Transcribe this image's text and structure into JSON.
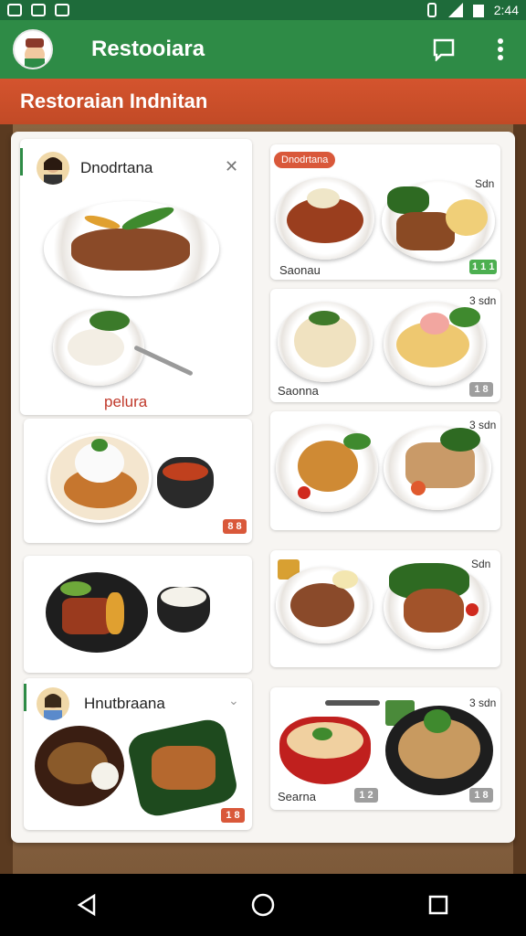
{
  "status_bar": {
    "time": "2:44"
  },
  "app_bar": {
    "title": "Restooiara"
  },
  "sub_header": {
    "title": "Restoraian Indnitan"
  },
  "left_cards": [
    {
      "title": "Dnodrtana",
      "label": "pelura"
    },
    {
      "badge": "8 8"
    },
    {},
    {
      "title": "Hnutbraana",
      "badge": "1 8"
    }
  ],
  "right_cards": [
    {
      "tag": "Dnodrtana",
      "corner": "Sdn",
      "caption": "Saonau",
      "badge": "1 1 1"
    },
    {
      "corner": "3 sdn",
      "caption": "Saonna",
      "badge": "1 8"
    },
    {
      "corner": "3 sdn"
    },
    {
      "corner": "Sdn"
    },
    {
      "corner": "3 sdn",
      "caption": "Searna",
      "badge1": "1 2",
      "badge2": "1 8"
    }
  ],
  "colors": {
    "app_bar": "#2e8b46",
    "sub_header": "#d4542e",
    "status_bar": "#1e6b3a"
  }
}
